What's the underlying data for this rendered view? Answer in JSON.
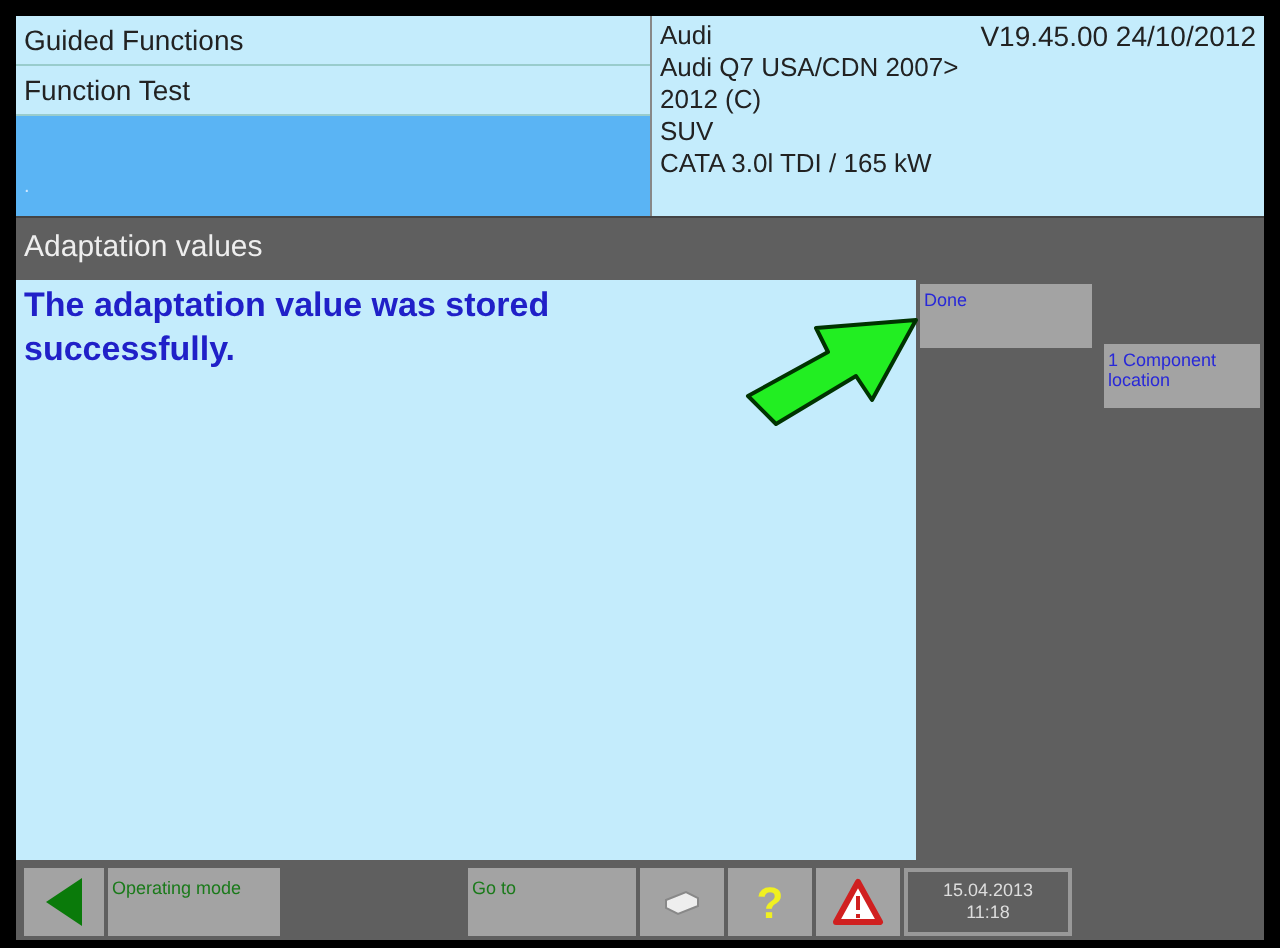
{
  "header": {
    "left_rows": [
      {
        "label": "Guided Functions",
        "selected": false
      },
      {
        "label": "Function Test",
        "selected": false
      },
      {
        "label": ".",
        "selected": true
      }
    ],
    "vehicle": {
      "make": "Audi",
      "version": "V19.45.00 24/10/2012",
      "lines": [
        "Audi Q7 USA/CDN 2007>",
        "2012 (C)",
        "SUV",
        "CATA 3.0l TDI / 165 kW"
      ]
    }
  },
  "title_bar": "Adaptation values",
  "message": "The adaptation value was stored successfully.",
  "side_buttons": [
    "Done",
    "1 Component location"
  ],
  "bottom_bar": {
    "operating_mode": "Operating mode",
    "go_to": "Go to",
    "help": "?",
    "date": "15.04.2013",
    "time": "11:18"
  }
}
